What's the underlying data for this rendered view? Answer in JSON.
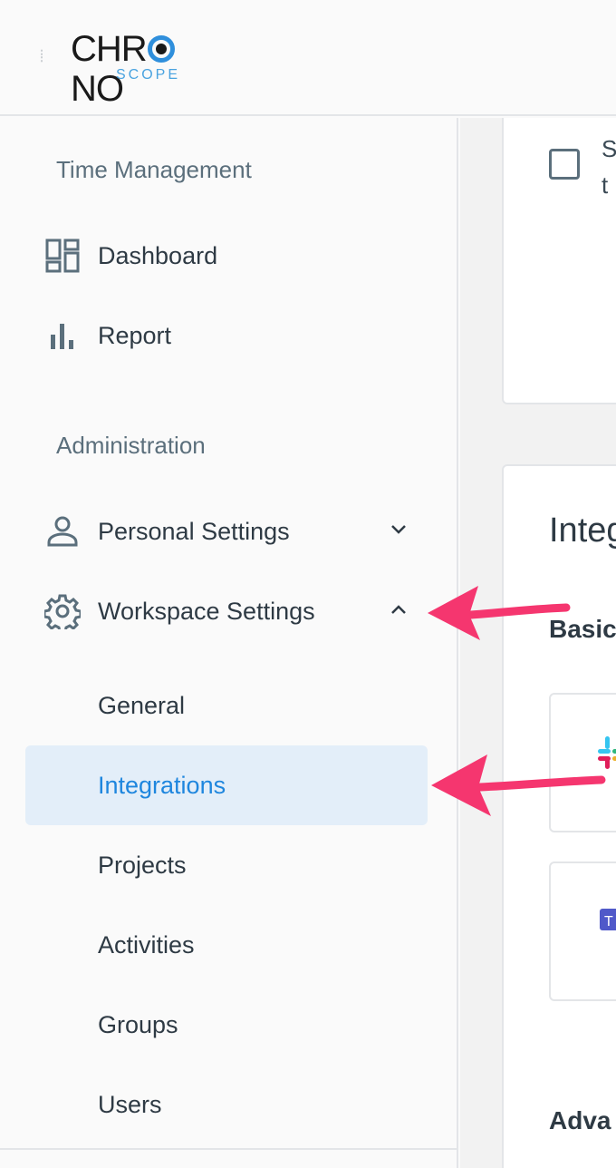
{
  "header": {
    "menu_icon": "hamburger-icon",
    "logo_main_left": "CHR",
    "logo_main_right": "NO",
    "logo_sub": "SCOPE"
  },
  "sidebar": {
    "section_time": "Time Management",
    "section_admin": "Administration",
    "items": [
      {
        "label": "Dashboard",
        "icon": "dashboard-icon"
      },
      {
        "label": "Report",
        "icon": "bar-chart-icon"
      },
      {
        "label": "Personal Settings",
        "icon": "person-icon",
        "chevron": "chevron-down-icon"
      },
      {
        "label": "Workspace Settings",
        "icon": "gear-icon",
        "chevron": "chevron-up-icon"
      }
    ],
    "workspace_subitems": [
      {
        "label": "General"
      },
      {
        "label": "Integrations",
        "active": true
      },
      {
        "label": "Projects"
      },
      {
        "label": "Activities"
      },
      {
        "label": "Groups"
      },
      {
        "label": "Users"
      }
    ]
  },
  "main": {
    "checkbox_text_line1": "S",
    "checkbox_text_line2": "t",
    "integrations_heading": "Integ",
    "basic_heading": "Basic",
    "advanced_heading": "Adva",
    "tiles": [
      {
        "icon": "slack-icon"
      },
      {
        "icon": "teams-icon"
      }
    ]
  },
  "annotations": {
    "arrow_color": "#f5366f"
  },
  "colors": {
    "accent": "#1e86de",
    "active_bg": "#e3eef9",
    "text": "#2e3a44",
    "section_text": "#5b6f7c"
  }
}
